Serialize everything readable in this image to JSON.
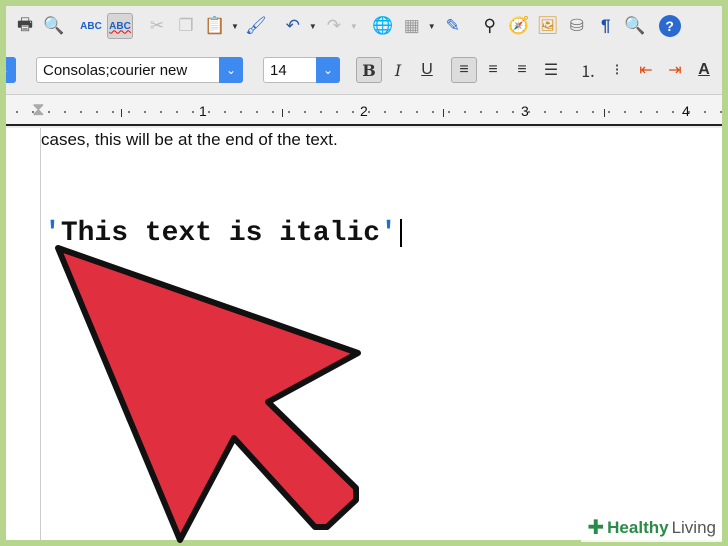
{
  "toolbar": {
    "icons": [
      "print-icon",
      "print-preview-icon",
      "spellcheck-icon",
      "autospellcheck-icon",
      "cut-icon",
      "copy-icon",
      "paste-icon",
      "clone-formatting-icon",
      "undo-icon",
      "redo-icon",
      "hyperlink-icon",
      "table-icon",
      "draw-icon",
      "find-icon",
      "navigator-icon",
      "gallery-icon",
      "datasource-icon",
      "formatting-marks-icon",
      "zoom-icon",
      "help-icon"
    ]
  },
  "format": {
    "font_name": "Consolas;courier new",
    "font_size": "14",
    "bold": "B",
    "italic": "I",
    "underline": "U"
  },
  "ruler": {
    "labels": [
      "1",
      "2",
      "3",
      "4"
    ]
  },
  "document": {
    "line1": "cases, this will be at the end of the text.",
    "quote_open": "'",
    "code_text": "This text is italic",
    "quote_close": "'"
  },
  "watermark": {
    "brand": "Healthy",
    "suffix": "Living"
  },
  "colors": {
    "arrow": "#e03040",
    "accent": "#3e8af0",
    "frame": "#b6d68e"
  }
}
